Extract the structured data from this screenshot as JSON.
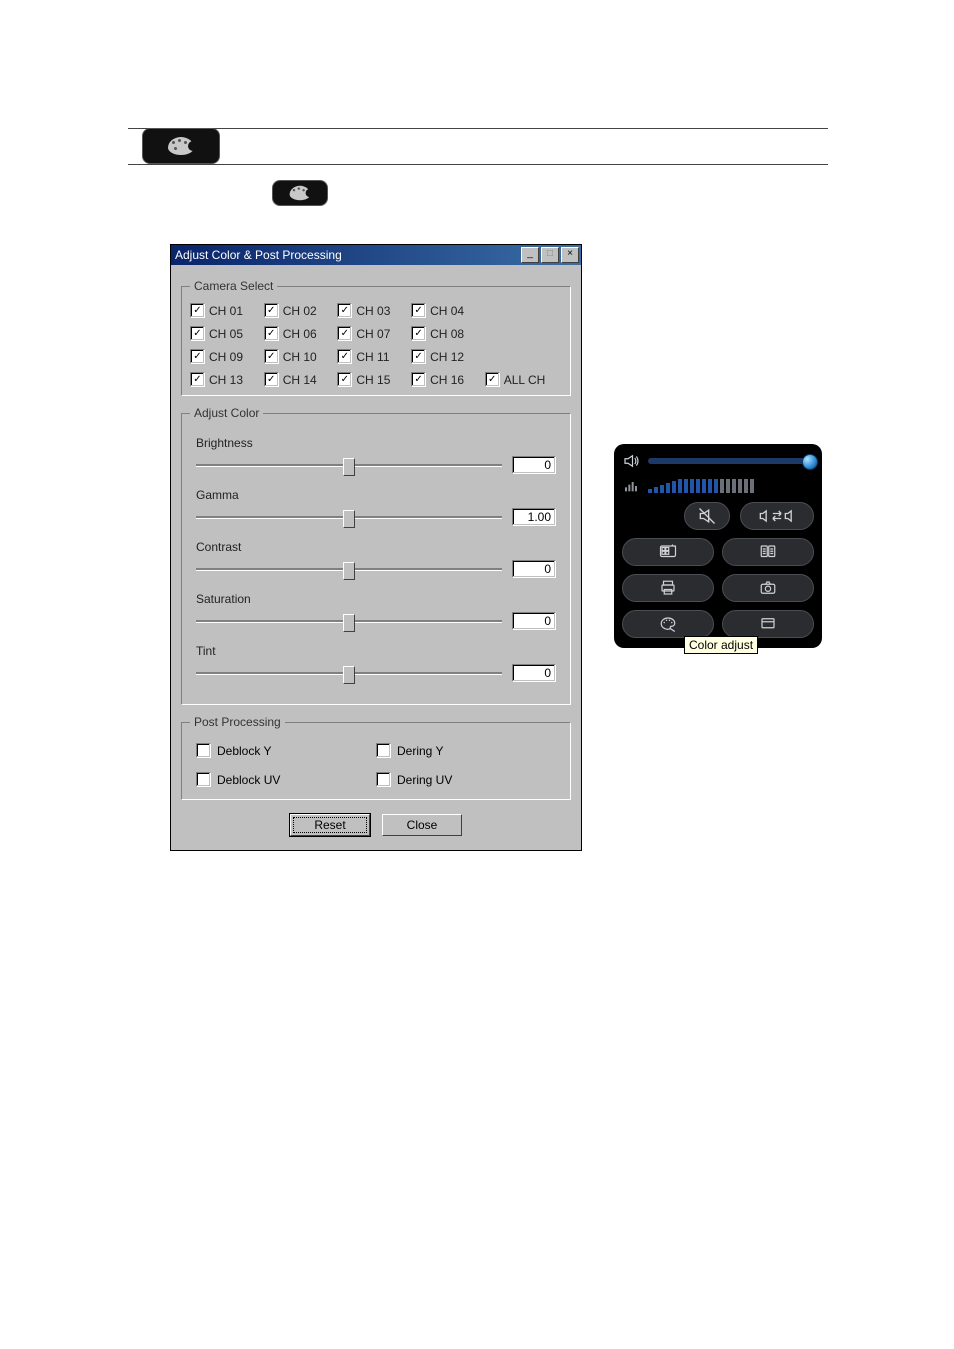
{
  "dialog": {
    "title": "Adjust Color & Post Processing",
    "groups": {
      "camera_select": {
        "legend": "Camera Select",
        "channels": [
          {
            "label": "CH 01",
            "checked": true
          },
          {
            "label": "CH 02",
            "checked": true
          },
          {
            "label": "CH 03",
            "checked": true
          },
          {
            "label": "CH 04",
            "checked": true
          },
          {
            "label": "CH 05",
            "checked": true
          },
          {
            "label": "CH 06",
            "checked": true
          },
          {
            "label": "CH 07",
            "checked": true
          },
          {
            "label": "CH 08",
            "checked": true
          },
          {
            "label": "CH 09",
            "checked": true
          },
          {
            "label": "CH 10",
            "checked": true
          },
          {
            "label": "CH 11",
            "checked": true
          },
          {
            "label": "CH 12",
            "checked": true
          },
          {
            "label": "CH 13",
            "checked": true
          },
          {
            "label": "CH 14",
            "checked": true
          },
          {
            "label": "CH 15",
            "checked": true
          },
          {
            "label": "CH 16",
            "checked": true
          },
          {
            "label": "ALL CH",
            "checked": true
          }
        ]
      },
      "adjust_color": {
        "legend": "Adjust Color",
        "sliders": [
          {
            "label": "Brightness",
            "value": "0"
          },
          {
            "label": "Gamma",
            "value": "1.00"
          },
          {
            "label": "Contrast",
            "value": "0"
          },
          {
            "label": "Saturation",
            "value": "0"
          },
          {
            "label": "Tint",
            "value": "0"
          }
        ]
      },
      "post_processing": {
        "legend": "Post Processing",
        "options": [
          {
            "label": "Deblock Y",
            "checked": false
          },
          {
            "label": "Dering Y",
            "checked": false
          },
          {
            "label": "Deblock UV",
            "checked": false
          },
          {
            "label": "Dering UV",
            "checked": false
          }
        ]
      }
    },
    "buttons": {
      "reset": "Reset",
      "close": "Close"
    },
    "titlebar_controls": {
      "minimize": "_",
      "maximize": "□",
      "close": "×"
    }
  },
  "tooltip": {
    "text": "Color adjust"
  },
  "control_panel": {
    "buttons": {
      "speaker": "speaker",
      "level_meter": "level-meter",
      "mute": "mute",
      "audio_swap": "audio-swap",
      "display_mode": "display-mode",
      "channel_list": "channel-list",
      "print": "print",
      "snapshot": "snapshot",
      "color_adjust": "color-adjust",
      "layout": "layout"
    }
  }
}
